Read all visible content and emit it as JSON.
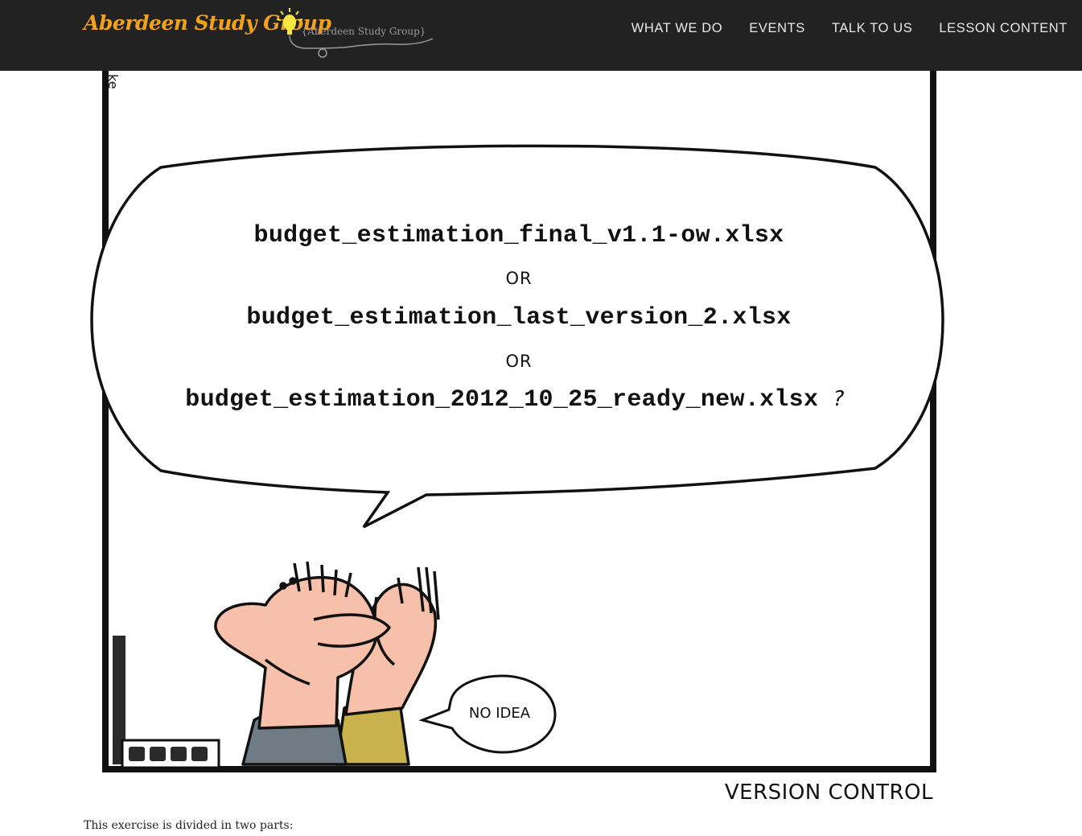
{
  "site": {
    "brand": "Aberdeen Study Group",
    "logo_text": "{Aberdeen Study Group}"
  },
  "nav": {
    "items": [
      {
        "label": "WHAT WE DO"
      },
      {
        "label": "EVENTS"
      },
      {
        "label": "TALK TO US"
      },
      {
        "label": "LESSON CONTENT"
      }
    ]
  },
  "comic": {
    "side_text": "ke",
    "filenames": [
      "budget_estimation_final_v1.1-ow.xlsx",
      "budget_estimation_last_version_2.xlsx",
      "budget_estimation_2012_10_25_ready_new.xlsx"
    ],
    "or_label": "OR",
    "question_mark": "?",
    "reply": "NO IDEA",
    "caption": "VERSION CONTROL"
  },
  "body": {
    "intro": "This exercise is divided in two parts:"
  },
  "colors": {
    "nav_bg": "#222222",
    "brand": "#f0a21c",
    "skin": "#f6c0aa",
    "shirt_grey": "#6f7c86",
    "shirt_yellow": "#c9b24e"
  }
}
